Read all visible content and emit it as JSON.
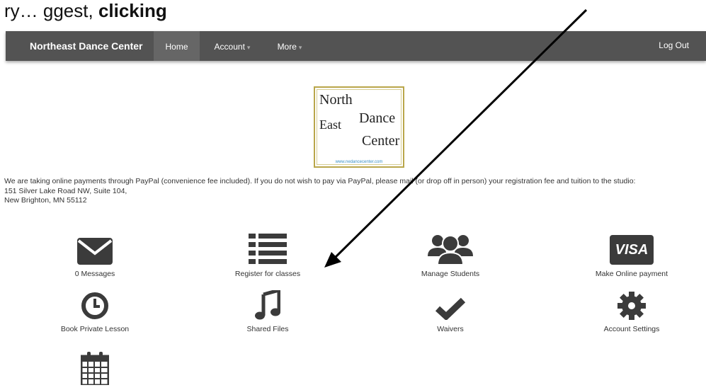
{
  "banner": {
    "prefix": "ry… ggest, ",
    "bold": "clicking"
  },
  "navbar": {
    "brand": "Northeast Dance Center",
    "items": [
      {
        "label": "Home"
      },
      {
        "label": "Account"
      },
      {
        "label": "More"
      }
    ],
    "logout": "Log Out",
    "caret": "▾"
  },
  "logo": {
    "line1": "North",
    "line2a": "East",
    "line2b": "Dance",
    "line3": "Center",
    "url": "www.nedancecenter.com"
  },
  "notice": {
    "text": "We are taking online payments through PayPal (convenience fee included). If you do not wish to pay via PayPal, please mail (or drop off in person) your registration fee and tuition to the studio:",
    "address1": "151 Silver Lake Road NW, Suite 104,",
    "address2": "New Brighton, MN 55112"
  },
  "tiles": [
    {
      "label": "0 Messages",
      "icon": "envelope-icon"
    },
    {
      "label": "Register for classes",
      "icon": "list-icon"
    },
    {
      "label": "Manage Students",
      "icon": "users-icon"
    },
    {
      "label": "Make Online payment",
      "icon": "visa-icon",
      "icon_text": "VISA"
    },
    {
      "label": "Book Private Lesson",
      "icon": "clock-icon"
    },
    {
      "label": "Shared Files",
      "icon": "music-note-icon"
    },
    {
      "label": "Waivers",
      "icon": "checkmark-icon"
    },
    {
      "label": "Account Settings",
      "icon": "gear-icon"
    },
    {
      "label": "",
      "icon": "calendar-icon"
    }
  ],
  "colors": {
    "navbar": "#535353",
    "icon": "#3b3b3b",
    "logo_border": "#b9a64a",
    "logo_url": "#3a8fc4"
  }
}
